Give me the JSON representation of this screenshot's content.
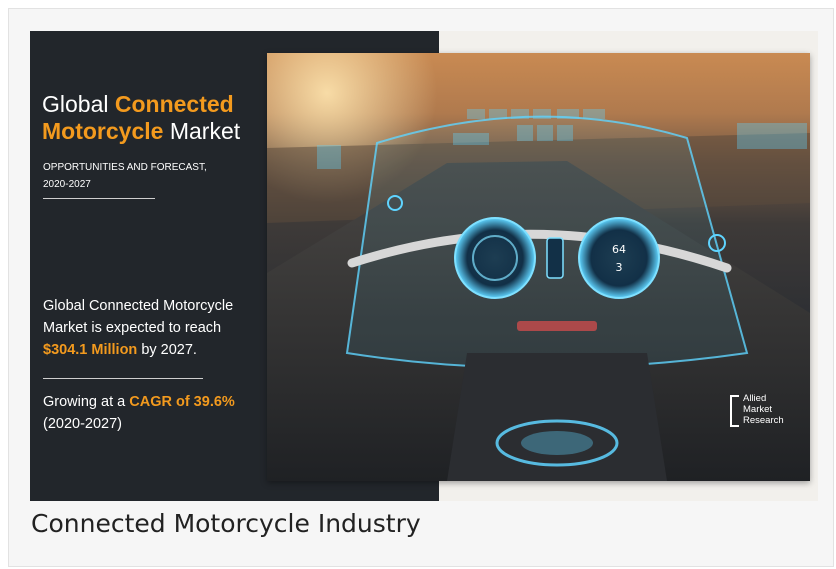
{
  "infographic": {
    "title_parts": {
      "a": "Global ",
      "b": "Connected",
      "c": "Motorcycle",
      "d": " Market"
    },
    "subtitle_line1": "OPPORTUNITIES AND FORECAST,",
    "subtitle_line2": "2020-2027",
    "stat1": {
      "line1": "Global Connected Motorcycle",
      "line2": "Market is expected to reach",
      "value": "$304.1 Million",
      "suffix": " by 2027."
    },
    "stat2": {
      "prefix": "Growing at a ",
      "highlight": "CAGR of 39.6%",
      "period": "(2020-2027)"
    },
    "hud_readout": {
      "speed": "64",
      "gear": "3"
    },
    "logo": {
      "line1": "Allied",
      "line2": "Market",
      "line3": "Research"
    },
    "colors": {
      "accent": "#f39a1e",
      "panel": "#22262b",
      "hud": "#5fd4ff"
    }
  },
  "caption": "Connected Motorcycle Industry"
}
